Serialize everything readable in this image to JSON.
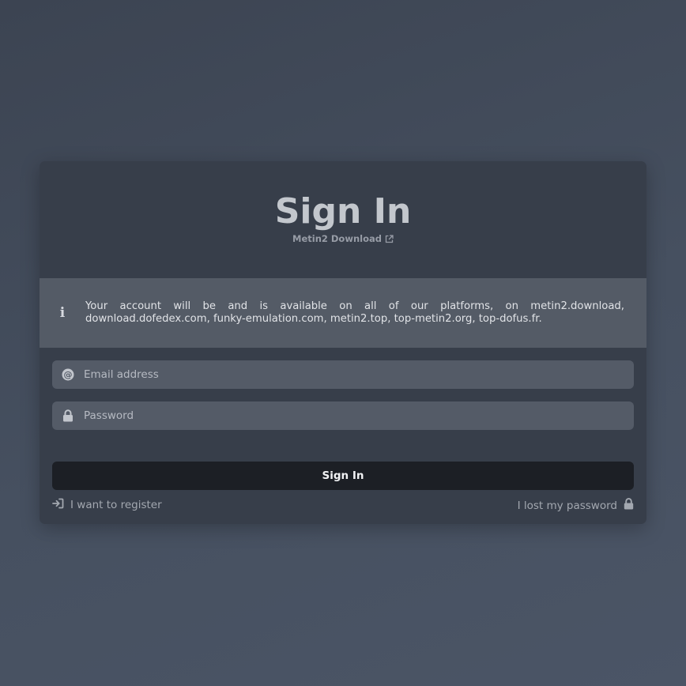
{
  "header": {
    "title": "Sign In",
    "subtitle_link": "Metin2 Download",
    "subtitle_icon": "external-link-icon"
  },
  "info": {
    "icon": "info-icon",
    "text": "Your account will be and is available on all of our platforms, on metin2.download, download.dofedex.com, funky-emulation.com, metin2.top, top-metin2.org, top-dofus.fr."
  },
  "form": {
    "email": {
      "placeholder": "Email address",
      "value": "",
      "icon": "at-sign-icon"
    },
    "password": {
      "placeholder": "Password",
      "value": "",
      "icon": "lock-icon"
    },
    "submit_label": "Sign In"
  },
  "footer": {
    "register_label": "I want to register",
    "register_icon": "sign-in-icon",
    "lost_password_label": "I lost my password",
    "lost_password_icon": "lock-icon"
  },
  "colors": {
    "background": "#434b59",
    "card": "#373e4a",
    "info_band": "#545b66",
    "input": "#545b67",
    "button": "#1c1f25"
  }
}
